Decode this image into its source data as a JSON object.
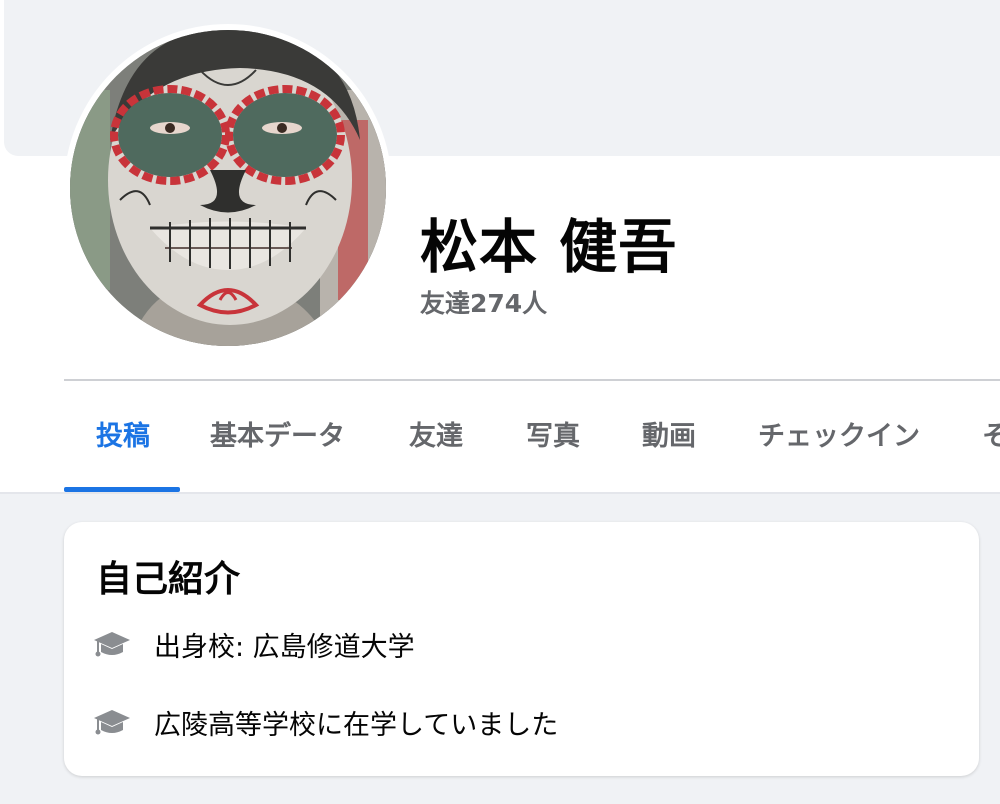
{
  "profile": {
    "name": "松本 健吾",
    "friends_count": "友達274人"
  },
  "tabs": [
    {
      "label": "投稿",
      "active": true
    },
    {
      "label": "基本データ"
    },
    {
      "label": "友達"
    },
    {
      "label": "写真"
    },
    {
      "label": "動画"
    },
    {
      "label": "チェックイン"
    },
    {
      "label": "そ"
    }
  ],
  "intro": {
    "title": "自己紹介",
    "items": [
      {
        "icon": "graduation-cap-icon",
        "text": "出身校: 広島修道大学"
      },
      {
        "icon": "graduation-cap-icon",
        "text": "広陵高等学校に在学していました"
      }
    ]
  },
  "colors": {
    "accent": "#1b74e4",
    "background": "#f0f2f5",
    "secondary_text": "#65676b"
  }
}
